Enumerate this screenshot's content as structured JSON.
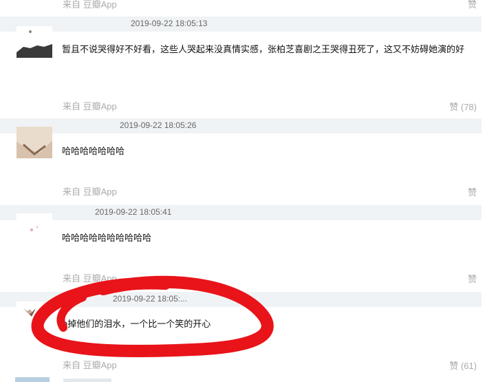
{
  "top_partial": {
    "source": "来自 豆瓣App",
    "like": "赞"
  },
  "comments": [
    {
      "timestamp": "2019-09-22 18:05:13",
      "text": "暂且不说哭得好不好看，这些人哭起来没真情实感，张柏芝喜剧之王哭得丑死了，这又不妨碍她演的好",
      "source": "来自 豆瓣App",
      "like": "赞 (78)"
    },
    {
      "timestamp": "2019-09-22 18:05:26",
      "text": "哈哈哈哈哈哈哈",
      "source": "来自 豆瓣App",
      "like": "赞"
    },
    {
      "timestamp": "2019-09-22 18:05:41",
      "text": "哈哈哈哈哈哈哈哈哈哈",
      "source": "来自 豆瓣App",
      "like": "赞"
    },
    {
      "timestamp": "2019-09-22 18:05:...",
      "text": "p掉他们的泪水，一个比一个笑的开心",
      "source": "来自 豆瓣App",
      "like": "赞 (61)"
    }
  ],
  "colors": {
    "meta_bar": "#f0f3f5",
    "muted_text": "#aaaaaa",
    "timestamp": "#666666",
    "annotation_red": "#e8141a"
  }
}
